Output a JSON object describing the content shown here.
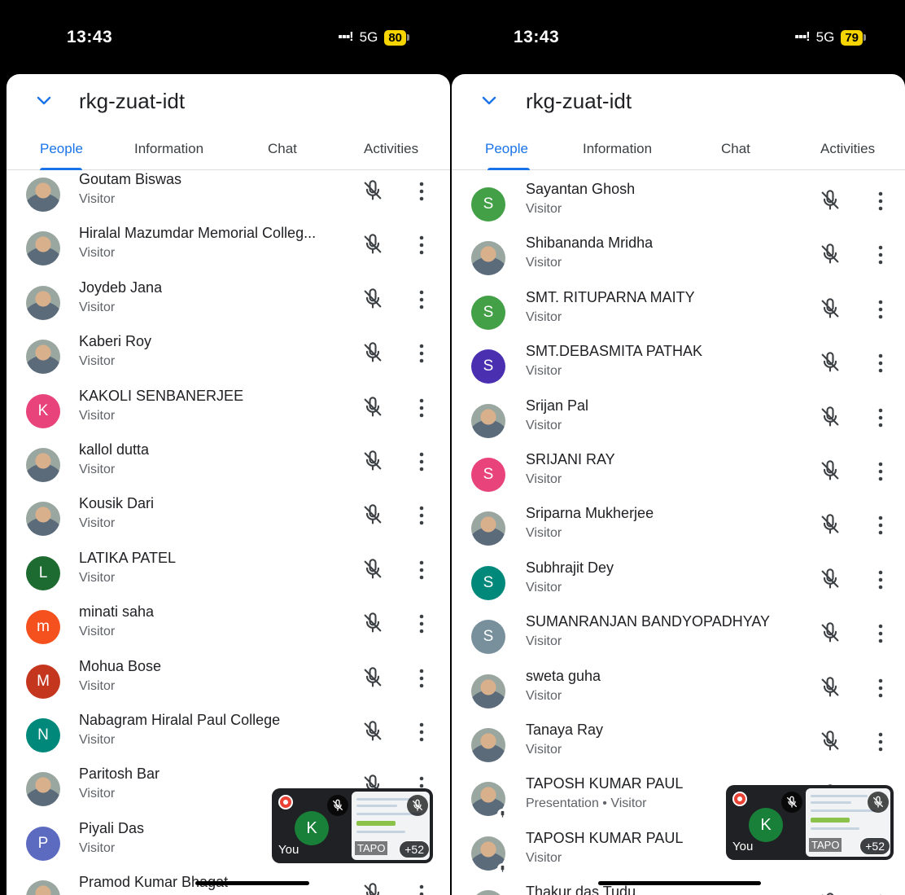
{
  "left": {
    "status": {
      "time": "13:43",
      "network": "5G",
      "battery": "80"
    },
    "room_title": "rkg-zuat-idt",
    "tabs": [
      "People",
      "Information",
      "Chat",
      "Activities"
    ],
    "participants": [
      {
        "name": "Goutam Biswas",
        "role": "Visitor",
        "avatar_letter": "",
        "avatar_color": ""
      },
      {
        "name": "Hiralal Mazumdar Memorial Colleg...",
        "role": "Visitor",
        "avatar_letter": "",
        "avatar_color": ""
      },
      {
        "name": "Joydeb Jana",
        "role": "Visitor",
        "avatar_letter": "",
        "avatar_color": ""
      },
      {
        "name": "Kaberi Roy",
        "role": "Visitor",
        "avatar_letter": "",
        "avatar_color": ""
      },
      {
        "name": "KAKOLI SENBANERJEE",
        "role": "Visitor",
        "avatar_letter": "K",
        "avatar_color": "#e8437a"
      },
      {
        "name": "kallol dutta",
        "role": "Visitor",
        "avatar_letter": "",
        "avatar_color": ""
      },
      {
        "name": "Kousik Dari",
        "role": "Visitor",
        "avatar_letter": "",
        "avatar_color": ""
      },
      {
        "name": "LATIKA PATEL",
        "role": "Visitor",
        "avatar_letter": "L",
        "avatar_color": "#1e6b32"
      },
      {
        "name": "minati saha",
        "role": "Visitor",
        "avatar_letter": "m",
        "avatar_color": "#f4511e"
      },
      {
        "name": "Mohua Bose",
        "role": "Visitor",
        "avatar_letter": "M",
        "avatar_color": "#c5361f"
      },
      {
        "name": "Nabagram Hiralal Paul College",
        "role": "Visitor",
        "avatar_letter": "N",
        "avatar_color": "#00897b"
      },
      {
        "name": "Paritosh Bar",
        "role": "Visitor",
        "avatar_letter": "",
        "avatar_color": ""
      },
      {
        "name": "Piyali Das",
        "role": "Visitor",
        "avatar_letter": "P",
        "avatar_color": "#5c6bc0"
      },
      {
        "name": "Pramod Kumar Bhagat",
        "role": "",
        "avatar_letter": "",
        "avatar_color": ""
      }
    ],
    "pip": {
      "avatar_letter": "K",
      "you_label": "You",
      "more_count": "+52",
      "screen_label": "TAPO"
    }
  },
  "right": {
    "status": {
      "time": "13:43",
      "network": "5G",
      "battery": "79"
    },
    "room_title": "rkg-zuat-idt",
    "tabs": [
      "People",
      "Information",
      "Chat",
      "Activities"
    ],
    "participants": [
      {
        "name": "Sayantan Ghosh",
        "role": "Visitor",
        "avatar_letter": "S",
        "avatar_color": "#43a047"
      },
      {
        "name": "Shibananda Mridha",
        "role": "Visitor",
        "avatar_letter": "",
        "avatar_color": ""
      },
      {
        "name": "SMT. RITUPARNA MAITY",
        "role": "Visitor",
        "avatar_letter": "S",
        "avatar_color": "#43a047"
      },
      {
        "name": "SMT.DEBASMITA PATHAK",
        "role": "Visitor",
        "avatar_letter": "S",
        "avatar_color": "#4a2fb0"
      },
      {
        "name": "Srijan Pal",
        "role": "Visitor",
        "avatar_letter": "",
        "avatar_color": ""
      },
      {
        "name": "SRIJANI RAY",
        "role": "Visitor",
        "avatar_letter": "S",
        "avatar_color": "#e8437a"
      },
      {
        "name": "Sriparna Mukherjee",
        "role": "Visitor",
        "avatar_letter": "",
        "avatar_color": ""
      },
      {
        "name": "Subhrajit Dey",
        "role": "Visitor",
        "avatar_letter": "S",
        "avatar_color": "#00897b"
      },
      {
        "name": "SUMANRANJAN BANDYOPADHYAY",
        "role": "Visitor",
        "avatar_letter": "S",
        "avatar_color": "#78909c"
      },
      {
        "name": "sweta guha",
        "role": "Visitor",
        "avatar_letter": "",
        "avatar_color": ""
      },
      {
        "name": "Tanaya Ray",
        "role": "Visitor",
        "avatar_letter": "",
        "avatar_color": ""
      },
      {
        "name": "TAPOSH KUMAR PAUL",
        "role": "Presentation • Visitor",
        "avatar_letter": "",
        "avatar_color": ""
      },
      {
        "name": "TAPOSH KUMAR PAUL",
        "role": "Visitor",
        "avatar_letter": "",
        "avatar_color": ""
      },
      {
        "name": "Thakur das Tudu",
        "role": "",
        "avatar_letter": "",
        "avatar_color": ""
      }
    ],
    "pip": {
      "avatar_letter": "K",
      "you_label": "You",
      "more_count": "+52",
      "screen_label": "TAPO"
    }
  },
  "colors": {
    "accent": "#1a73e8",
    "text_primary": "#202124",
    "text_secondary": "#5f6368"
  }
}
